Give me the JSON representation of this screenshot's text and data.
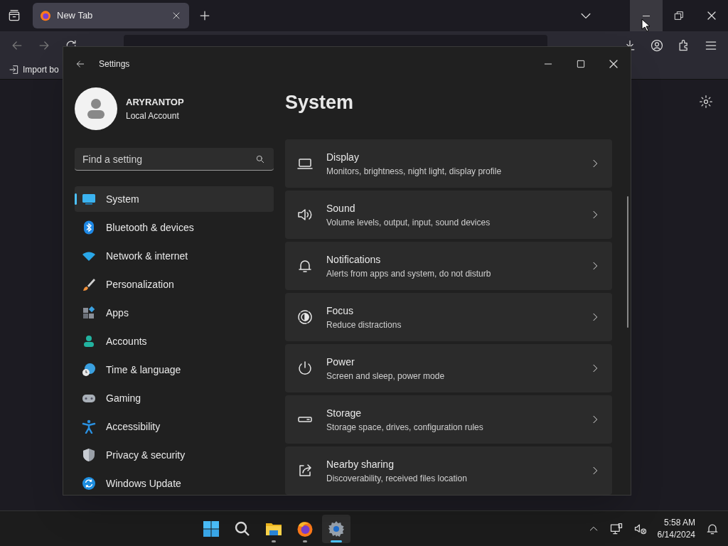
{
  "browser": {
    "tabs": [
      {
        "label": "New Tab",
        "selected": true
      }
    ],
    "bookmarks": [
      {
        "label": "Import bo"
      }
    ]
  },
  "settings": {
    "title": "Settings",
    "user": {
      "name": "ARYRANTOP",
      "account": "Local Account"
    },
    "search": {
      "placeholder": "Find a setting"
    },
    "nav": [
      {
        "kind": "system",
        "label": "System",
        "selected": true
      },
      {
        "kind": "bluetooth",
        "label": "Bluetooth & devices",
        "selected": false
      },
      {
        "kind": "network",
        "label": "Network & internet",
        "selected": false
      },
      {
        "kind": "personalization",
        "label": "Personalization",
        "selected": false
      },
      {
        "kind": "apps",
        "label": "Apps",
        "selected": false
      },
      {
        "kind": "accounts",
        "label": "Accounts",
        "selected": false
      },
      {
        "kind": "time",
        "label": "Time & language",
        "selected": false
      },
      {
        "kind": "gaming",
        "label": "Gaming",
        "selected": false
      },
      {
        "kind": "accessibility",
        "label": "Accessibility",
        "selected": false
      },
      {
        "kind": "privacy",
        "label": "Privacy & security",
        "selected": false
      },
      {
        "kind": "update",
        "label": "Windows Update",
        "selected": false
      }
    ],
    "heading": "System",
    "cards": [
      {
        "kind": "display",
        "title": "Display",
        "description": "Monitors, brightness, night light, display profile"
      },
      {
        "kind": "sound",
        "title": "Sound",
        "description": "Volume levels, output, input, sound devices"
      },
      {
        "kind": "notifications",
        "title": "Notifications",
        "description": "Alerts from apps and system, do not disturb"
      },
      {
        "kind": "focus",
        "title": "Focus",
        "description": "Reduce distractions"
      },
      {
        "kind": "power",
        "title": "Power",
        "description": "Screen and sleep, power mode"
      },
      {
        "kind": "storage",
        "title": "Storage",
        "description": "Storage space, drives, configuration rules"
      },
      {
        "kind": "sharing",
        "title": "Nearby sharing",
        "description": "Discoverability, received files location"
      }
    ]
  },
  "taskbar": {
    "apps": [
      {
        "kind": "start",
        "running": false,
        "selected": false
      },
      {
        "kind": "search",
        "running": false,
        "selected": false
      },
      {
        "kind": "explorer",
        "running": true,
        "selected": false
      },
      {
        "kind": "firefox",
        "running": true,
        "selected": false
      },
      {
        "kind": "settings",
        "running": true,
        "selected": true
      }
    ],
    "time": "5:58 AM",
    "date": "6/14/2024"
  }
}
